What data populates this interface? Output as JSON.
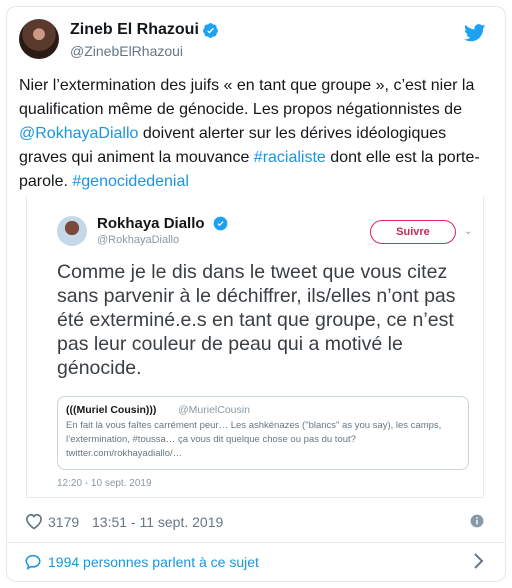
{
  "tweet": {
    "author_name": "Zineb El Rhazoui",
    "author_handle": "@ZinebElRhazoui",
    "text_1": "Nier l’extermination des juifs « en tant que groupe », c’est nier la qualification  même de génocide. Les propos négationnistes de ",
    "mention": "@RokhayaDiallo",
    "text_2": " doivent alerter sur les dérives idéologiques graves qui animent la mouvance ",
    "hashtag_1": "#racialiste",
    "text_3": " dont elle est la porte-parole. ",
    "hashtag_2": "#genocidedenial",
    "likes": "3179",
    "timestamp": "13:51 - 11 sept. 2019",
    "talk_label": "1994 personnes parlent à ce sujet"
  },
  "embedded": {
    "author_name": "Rokhaya Diallo",
    "author_handle": "@RokhayaDiallo",
    "follow_label": "Suivre",
    "text": "Comme je le dis dans le tweet que vous citez sans parvenir à le déchiffrer, ils/elles n’ont pas été exterminé.e.s en tant que groupe, ce n’est pas leur couleur de peau qui a motivé le génocide.",
    "timestamp": "12:20 - 10 sept. 2019",
    "quote": {
      "author_name": "(((Muriel Cousin)))",
      "author_handle": "@MurielCousin",
      "text": "En fait là vous faîtes carrément peur… Les ashkénazes (\"blancs\" as you say), les camps, l’extermination, #toussa… ça vous dit quelque chose ou pas du tout? twitter.com/rokhayadiallo/…"
    }
  },
  "icons": {
    "verified": "verified-badge-icon",
    "twitter": "twitter-bird-icon",
    "heart": "heart-icon",
    "info": "info-icon",
    "bubble": "speech-bubble-icon",
    "chevron": "chevron-right-icon"
  },
  "colors": {
    "link": "#1b95e0",
    "verified": "#1da1f2",
    "follow_border": "#e0245e",
    "secondary_text": "#657786"
  }
}
